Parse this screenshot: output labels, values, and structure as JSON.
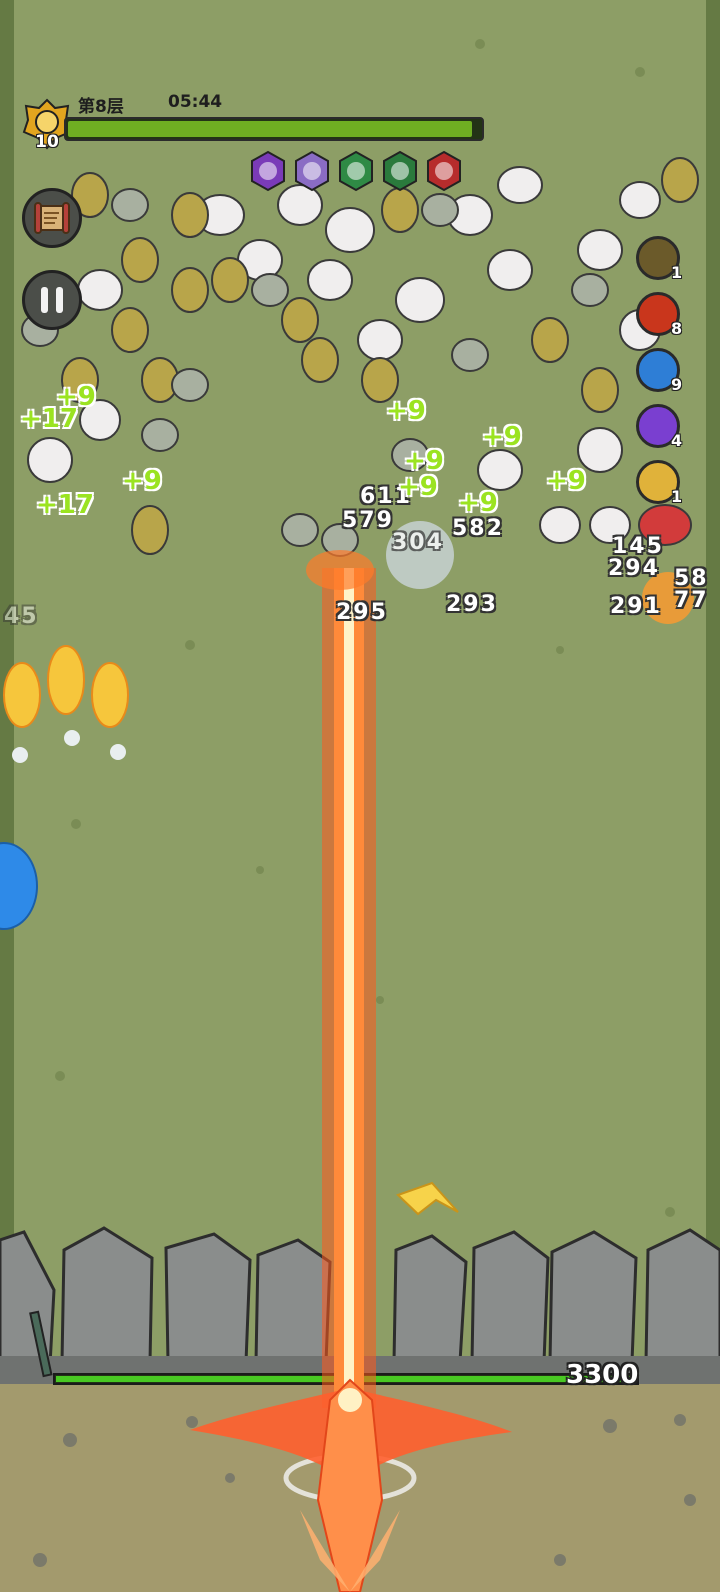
{
  "hud": {
    "stage_label": "第8层",
    "timer": "05:44",
    "level": "10",
    "boss_hp_fraction": 0.98,
    "colors": {
      "hp_fill": "#6fae22",
      "hp_track": "#233316"
    }
  },
  "buttons": {
    "scroll_icon": "scroll-icon",
    "pause_icon": "pause-icon"
  },
  "skills": [
    {
      "icon": "power-fist-icon",
      "color": "#7a3bb8"
    },
    {
      "icon": "swirl-icon",
      "color": "#8a6cc4"
    },
    {
      "icon": "green-vortex-icon",
      "color": "#2f8a45"
    },
    {
      "icon": "green-sprout-icon",
      "color": "#2a7a3c"
    },
    {
      "icon": "red-flame-icon",
      "color": "#b72c2c"
    }
  ],
  "powers": [
    {
      "icon": "bow-icon",
      "count": "1",
      "color": "#6b5a2a"
    },
    {
      "icon": "fire-sword-icon",
      "count": "8",
      "color": "#c9361c"
    },
    {
      "icon": "ghost-icon",
      "count": "9",
      "color": "#2e7ed6"
    },
    {
      "icon": "lightning-icon",
      "count": "4",
      "color": "#7a3fd0"
    },
    {
      "icon": "pie-icon",
      "count": "1",
      "color": "#e0b23a"
    }
  ],
  "damage_numbers": [
    "611",
    "579",
    "304",
    "582",
    "295",
    "293",
    "145",
    "294",
    "291",
    "58",
    "77",
    "45"
  ],
  "heal_numbers": [
    "+9",
    "+17",
    "+9",
    "+17",
    "+9",
    "+9",
    "+9",
    "+9",
    "+9",
    "+9"
  ],
  "wall_hp": "3300",
  "wall_hp_fraction": 1.0
}
